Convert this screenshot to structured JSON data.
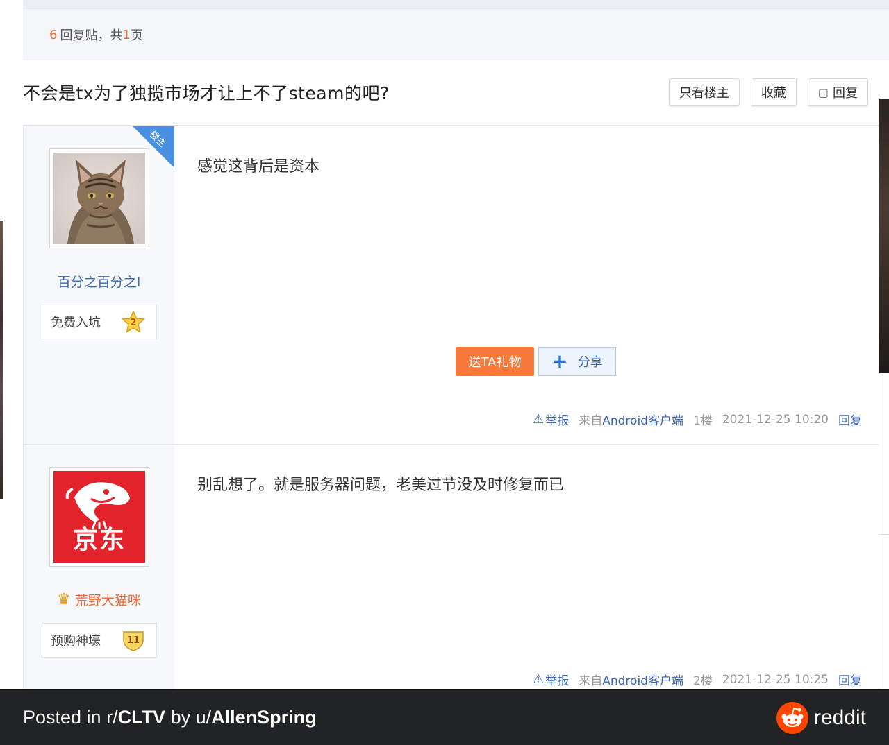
{
  "reply_bar": {
    "count": "6",
    "text_before_pages": "回复贴，共",
    "pages": "1",
    "text_after": "页"
  },
  "thread": {
    "title": "不会是tx为了独揽市场才让上不了steam的吧?",
    "actions": {
      "only_op": "只看楼主",
      "favorite": "收藏",
      "reply": "回复"
    }
  },
  "posts": [
    {
      "op_tag": "楼主",
      "username": "百分之百分之I",
      "badge_label": "免费入坑",
      "badge_level": "2",
      "content": "感觉这背后是资本",
      "gift_label": "送TA礼物",
      "share_label": "分享",
      "report_label": "举报",
      "client_prefix": "来自",
      "client_name": "Android客户端",
      "floor": "1楼",
      "time": "2021-12-25 10:20",
      "reply_label": "回复"
    },
    {
      "avatar_text": "京东",
      "username": "荒野大猫咪",
      "badge_label": "预购神壕",
      "badge_level": "11",
      "content": "别乱想了。就是服务器问题，老美过节没及时修复而已",
      "report_label": "举报",
      "client_prefix": "来自",
      "client_name": "Android客户端",
      "floor": "2楼",
      "time": "2021-12-25 10:25",
      "reply_label": "回复"
    }
  ],
  "footer": {
    "posted_in": "Posted in r/",
    "subreddit": "CLTV",
    "by": " by u/",
    "user": "AllenSpring",
    "brand": "reddit"
  },
  "colors": {
    "accent_blue": "#3a66b5",
    "gift_orange": "#f77a3a",
    "footer_bg": "#222324",
    "reddit_orange": "#ff4500"
  }
}
